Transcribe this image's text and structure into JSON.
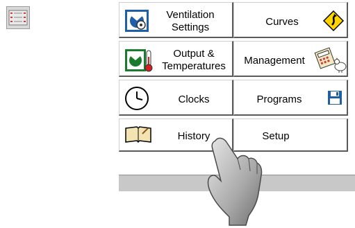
{
  "menu": {
    "ventilation_settings": "Ventilation\nSettings",
    "curves": "Curves",
    "output_temperatures": "Output &\nTemperatures",
    "management": "Management",
    "clocks": "Clocks",
    "programs": "Programs",
    "history": "History",
    "setup": "Setup"
  },
  "icons": {
    "side": "control-panel-icon",
    "ventilation": "fan-settings-icon",
    "curves": "curve-road-sign-icon",
    "output": "fan-thermometer-icon",
    "management": "calculator-chicken-icon",
    "clocks": "clock-icon",
    "programs": "floppy-disk-icon",
    "history": "open-book-icon",
    "pointer": "pointing-hand-icon"
  },
  "colors": {
    "status_bar": "#c8c8c8",
    "icon_green": "#1a7a2e",
    "icon_blue": "#1f5fa8",
    "sign_yellow": "#ffd400"
  }
}
